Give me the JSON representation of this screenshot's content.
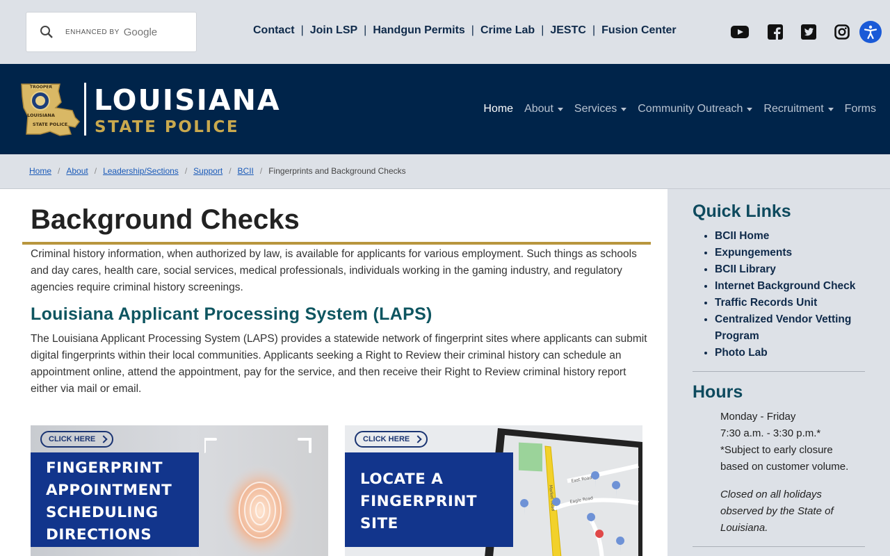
{
  "topbar": {
    "search": {
      "enhanced_by": "ENHANCED BY",
      "google": "Google"
    },
    "links": [
      "Contact",
      "Join LSP",
      "Handgun Permits",
      "Crime Lab",
      "JESTC",
      "Fusion Center"
    ],
    "social_icons": [
      "youtube-icon",
      "facebook-icon",
      "twitter-icon",
      "instagram-icon"
    ],
    "accessibility_icon": "accessibility-icon"
  },
  "header": {
    "logo_title": "LOUISIANA",
    "logo_subtitle": "STATE POLICE",
    "badge_text": {
      "top": "TROOPER",
      "middle": "LOUISIANA",
      "bottom": "STATE POLICE"
    },
    "nav": [
      {
        "label": "Home",
        "active": true,
        "dropdown": false
      },
      {
        "label": "About",
        "active": false,
        "dropdown": true
      },
      {
        "label": "Services",
        "active": false,
        "dropdown": true
      },
      {
        "label": "Community Outreach",
        "active": false,
        "dropdown": true
      },
      {
        "label": "Recruitment",
        "active": false,
        "dropdown": true
      },
      {
        "label": "Forms",
        "active": false,
        "dropdown": false
      }
    ]
  },
  "breadcrumb": {
    "items": [
      "Home",
      "About",
      "Leadership/Sections",
      "Support",
      "BCII"
    ],
    "current": "Fingerprints and Background Checks"
  },
  "main": {
    "title": "Background Checks",
    "intro": "Criminal history information, when authorized by law, is available for applicants for various employment. Such things as schools and day cares, health care, social services, medical professionals, individuals working in the gaming industry, and regulatory agencies require criminal history screenings.",
    "laps_heading": "Louisiana Applicant Processing System (LAPS)",
    "laps_text": "The Louisiana Applicant Processing System (LAPS) provides a statewide network of fingerprint sites where applicants can submit digital fingerprints within their local communities. Applicants seeking a Right to Review their criminal history can schedule an appointment online, attend the appointment, pay for the service, and then receive their Right to Review criminal history report either via mail or email.",
    "cards": [
      {
        "click_label": "CLICK HERE",
        "lines": [
          "FINGERPRINT",
          "APPOINTMENT",
          "SCHEDULING",
          "DIRECTIONS"
        ]
      },
      {
        "click_label": "CLICK HERE",
        "lines": [
          "LOCATE A",
          "FINGERPRINT",
          "SITE"
        ]
      }
    ],
    "map_street_labels": [
      "Market Road",
      "Eagle Road",
      "East Road"
    ]
  },
  "sidebar": {
    "quick_links_heading": "Quick Links",
    "quick_links": [
      "BCII Home",
      "Expungements",
      "BCII Library",
      "Internet Background Check",
      "Traffic Records Unit",
      "Centralized Vendor Vetting Program",
      "Photo Lab"
    ],
    "hours_heading": "Hours",
    "hours_lines": [
      "Monday - Friday",
      "7:30 a.m. - 3:30 p.m.*",
      "*Subject to early closure based on customer volume."
    ],
    "closed_note": "Closed on all holidays observed by the State of Louisiana."
  },
  "colors": {
    "navy": "#00244a",
    "gold": "#c9a94e",
    "teal_heading": "#0e5560",
    "link_blue": "#1a5ab8",
    "card_blue": "#12358c"
  }
}
